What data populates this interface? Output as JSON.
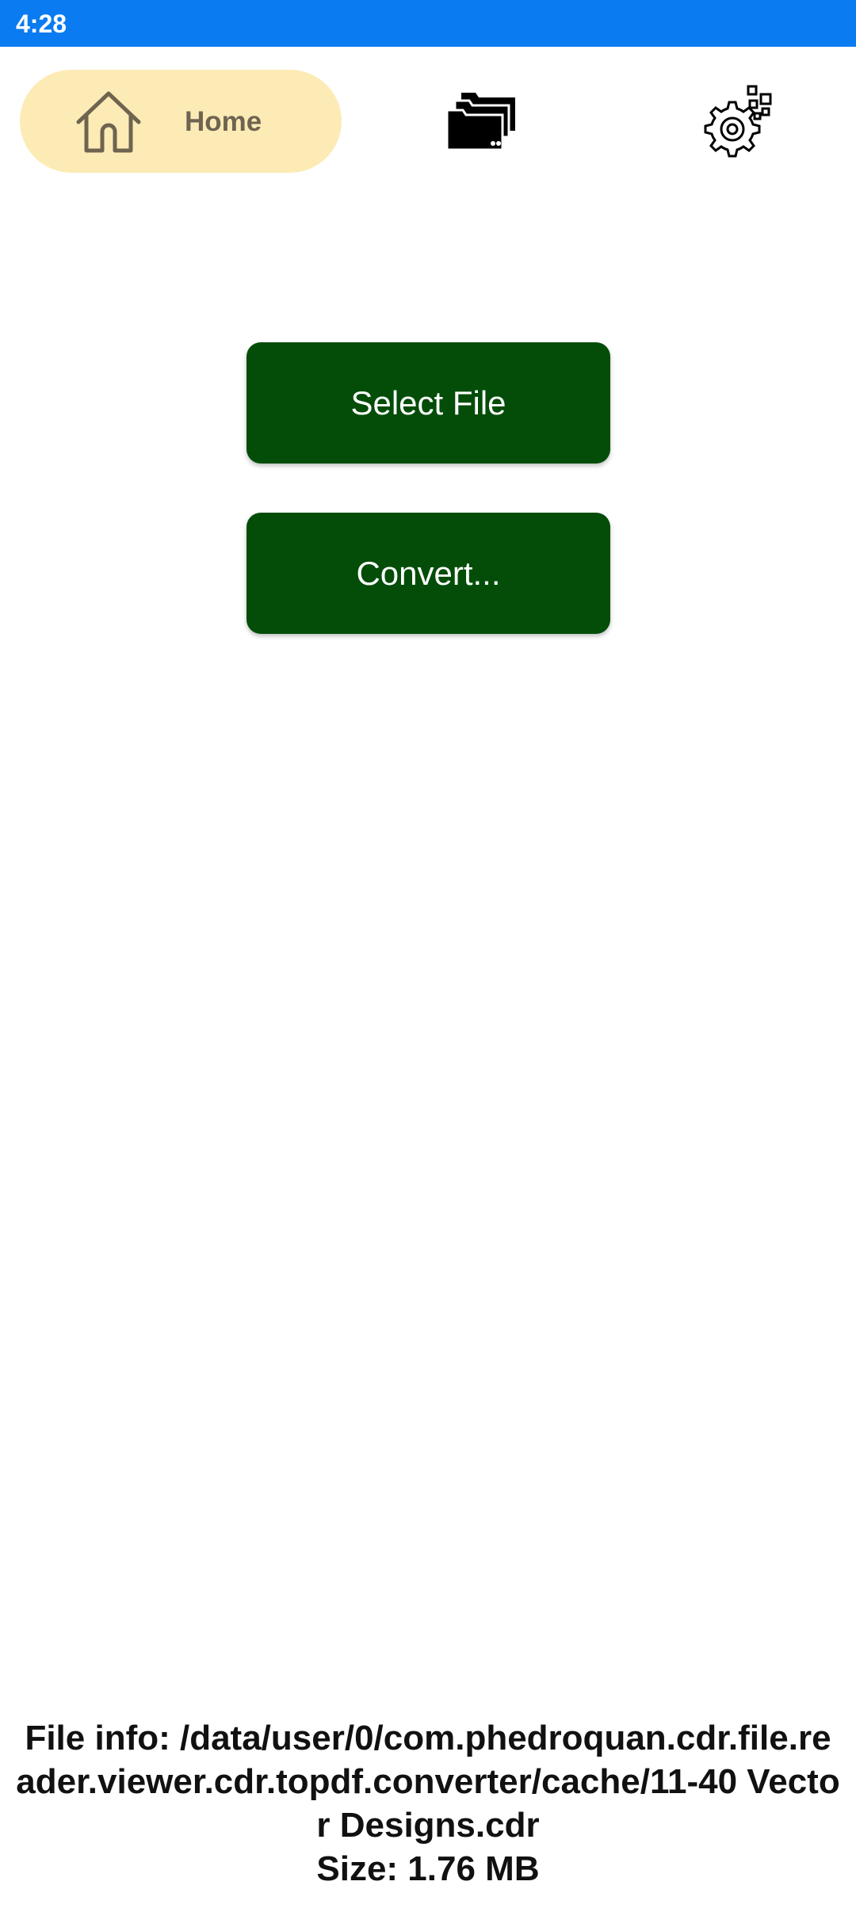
{
  "status_bar": {
    "time": "4:28",
    "color": "#0a7bf0"
  },
  "nav": {
    "home_label": "Home",
    "home_icon": "home-icon",
    "files_icon": "folders-icon",
    "settings_icon": "settings-gear-icon",
    "active_bg": "#fdebb6"
  },
  "actions": {
    "select_file_label": "Select File",
    "convert_label": "Convert...",
    "button_color": "#034d09"
  },
  "file_info": {
    "path_line": "File info: /data/user/0/com.phedroquan.cdr.file.reader.viewer.cdr.topdf.converter/cache/11-40 Vector Designs.cdr",
    "size_line": "Size: 1.76 MB"
  }
}
